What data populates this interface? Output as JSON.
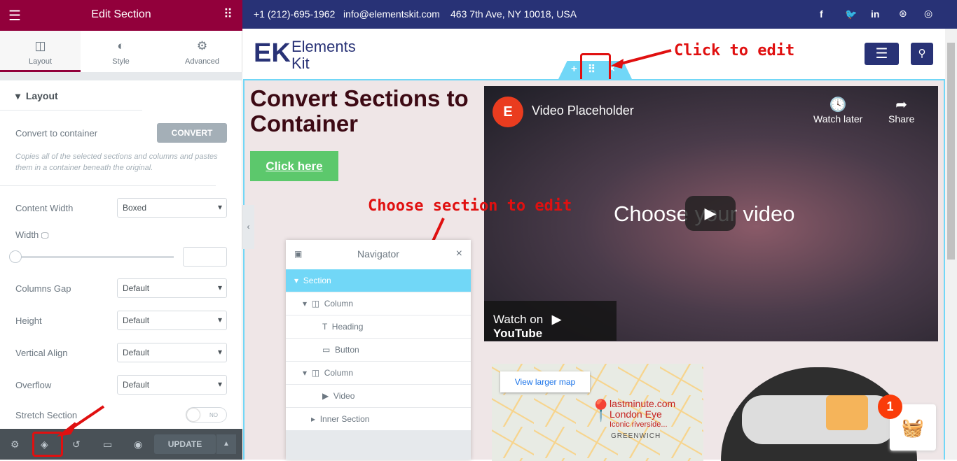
{
  "panel": {
    "title": "Edit Section",
    "tabs": [
      {
        "label": "Layout",
        "icon": "columns-icon"
      },
      {
        "label": "Style",
        "icon": "contrast-icon"
      },
      {
        "label": "Advanced",
        "icon": "gear-icon"
      }
    ],
    "section_title": "Layout",
    "convert_label": "Convert to container",
    "convert_button": "CONVERT",
    "convert_help": "Copies all of the selected sections and columns and pastes them in a container beneath the original.",
    "fields": [
      {
        "label": "Content Width",
        "value": "Boxed"
      },
      {
        "label": "Columns Gap",
        "value": "Default"
      },
      {
        "label": "Height",
        "value": "Default"
      },
      {
        "label": "Vertical Align",
        "value": "Default"
      },
      {
        "label": "Overflow",
        "value": "Default"
      }
    ],
    "width_label": "Width",
    "stretch_label": "Stretch Section",
    "stretch_value": "NO",
    "update": "UPDATE"
  },
  "site": {
    "phone": "+1 (212)-695-1962",
    "email": "info@elementskit.com",
    "address": "463 7th Ave, NY 10018, USA",
    "logo_line1": "Elements",
    "logo_line2": "Kit",
    "heading": "Convert Sections to Container",
    "button": "Click here",
    "video": {
      "title": "Video Placeholder",
      "watch_later": "Watch later",
      "share": "Share",
      "center": "Choose your video",
      "watch_on": "Watch on",
      "youtube": "YouTube"
    },
    "map": {
      "link": "View larger map",
      "place1": "lastminute.com",
      "place2": "London Eye",
      "place3": "Iconic riverside...",
      "area": "GREENWICH"
    },
    "cart_count": "1"
  },
  "navigator": {
    "title": "Navigator",
    "items": [
      {
        "label": "Section",
        "level": 0
      },
      {
        "label": "Column",
        "level": 1
      },
      {
        "label": "Heading",
        "level": 2
      },
      {
        "label": "Button",
        "level": 2
      },
      {
        "label": "Column",
        "level": 1
      },
      {
        "label": "Video",
        "level": 2
      },
      {
        "label": "Inner Section",
        "level": 1
      }
    ]
  },
  "annotations": {
    "click_to_edit": "Click to edit",
    "choose_section": "Choose section to edit"
  },
  "colors": {
    "brand": "#92003b",
    "topbar": "#283276",
    "selection": "#71d7f7",
    "annotation": "#e01010"
  }
}
